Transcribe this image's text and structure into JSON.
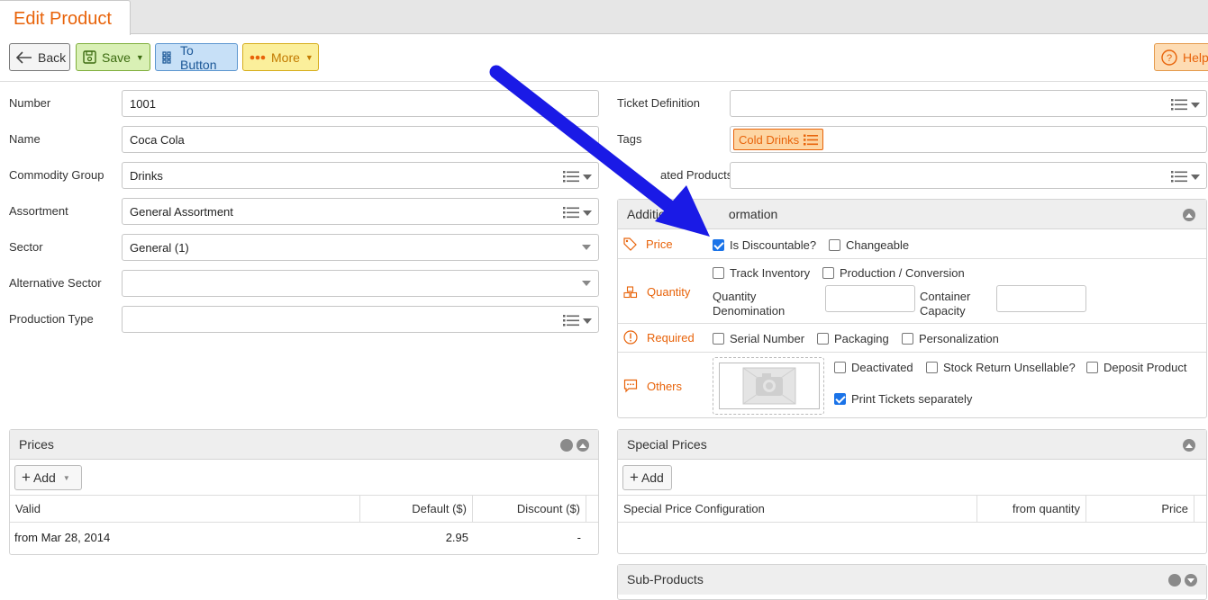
{
  "tab": {
    "title": "Edit Product"
  },
  "toolbar": {
    "back_label": "Back",
    "save_label": "Save",
    "to_button_label": "To Button",
    "more_label": "More",
    "help_label": "Help"
  },
  "form_left": {
    "number": {
      "label": "Number",
      "value": "1001"
    },
    "name": {
      "label": "Name",
      "value": "Coca Cola"
    },
    "commodity_group": {
      "label": "Commodity Group",
      "value": "Drinks"
    },
    "assortment": {
      "label": "Assortment",
      "value": "General Assortment"
    },
    "sector": {
      "label": "Sector",
      "value": "General (1)"
    },
    "alternative_sector": {
      "label": "Alternative Sector",
      "value": ""
    },
    "production_type": {
      "label": "Production Type",
      "value": ""
    }
  },
  "form_right": {
    "ticket_definition": {
      "label": "Ticket Definition",
      "value": ""
    },
    "tags": {
      "label": "Tags",
      "items": [
        "Cold Drinks"
      ]
    },
    "related_products": {
      "label": "ated Products",
      "value": ""
    }
  },
  "additional_info": {
    "title": "Additio",
    "title_tail": "ormation",
    "price": {
      "label": "Price",
      "is_discountable": {
        "label": "Is Discountable?",
        "checked": true
      },
      "changeable": {
        "label": "Changeable",
        "checked": false
      }
    },
    "quantity": {
      "label": "Quantity",
      "track_inventory": {
        "label": "Track Inventory",
        "checked": false
      },
      "production_conversion": {
        "label": "Production / Conversion",
        "checked": false
      },
      "quantity_denomination_line1": "Quantity",
      "quantity_denomination_line2": "Denomination",
      "container_capacity_line1": "Container",
      "container_capacity_line2": "Capacity"
    },
    "required": {
      "label": "Required",
      "serial_number": {
        "label": "Serial Number",
        "checked": false
      },
      "packaging": {
        "label": "Packaging",
        "checked": false
      },
      "personalization": {
        "label": "Personalization",
        "checked": false
      }
    },
    "others": {
      "label": "Others",
      "deactivated": {
        "label": "Deactivated",
        "checked": false
      },
      "stock_return_unsellable": {
        "label": "Stock Return Unsellable?",
        "checked": false
      },
      "deposit_product": {
        "label": "Deposit Product",
        "checked": false
      },
      "print_tickets_separately": {
        "label": "Print Tickets separately",
        "checked": true
      }
    }
  },
  "prices": {
    "title": "Prices",
    "add_label": "Add",
    "columns": [
      "Valid",
      "Default ($)",
      "Discount ($)"
    ],
    "rows": [
      {
        "valid": "from Mar 28, 2014",
        "default": "2.95",
        "discount": "-"
      }
    ]
  },
  "special_prices": {
    "title": "Special Prices",
    "add_label": "Add",
    "columns": [
      "Special Price Configuration",
      "from quantity",
      "Price"
    ]
  },
  "sub_products": {
    "title": "Sub-Products"
  },
  "colors": {
    "accent_orange": "#e8630a",
    "annotation_arrow": "#1a1ae6",
    "checkbox_checked": "#1a73e8"
  }
}
